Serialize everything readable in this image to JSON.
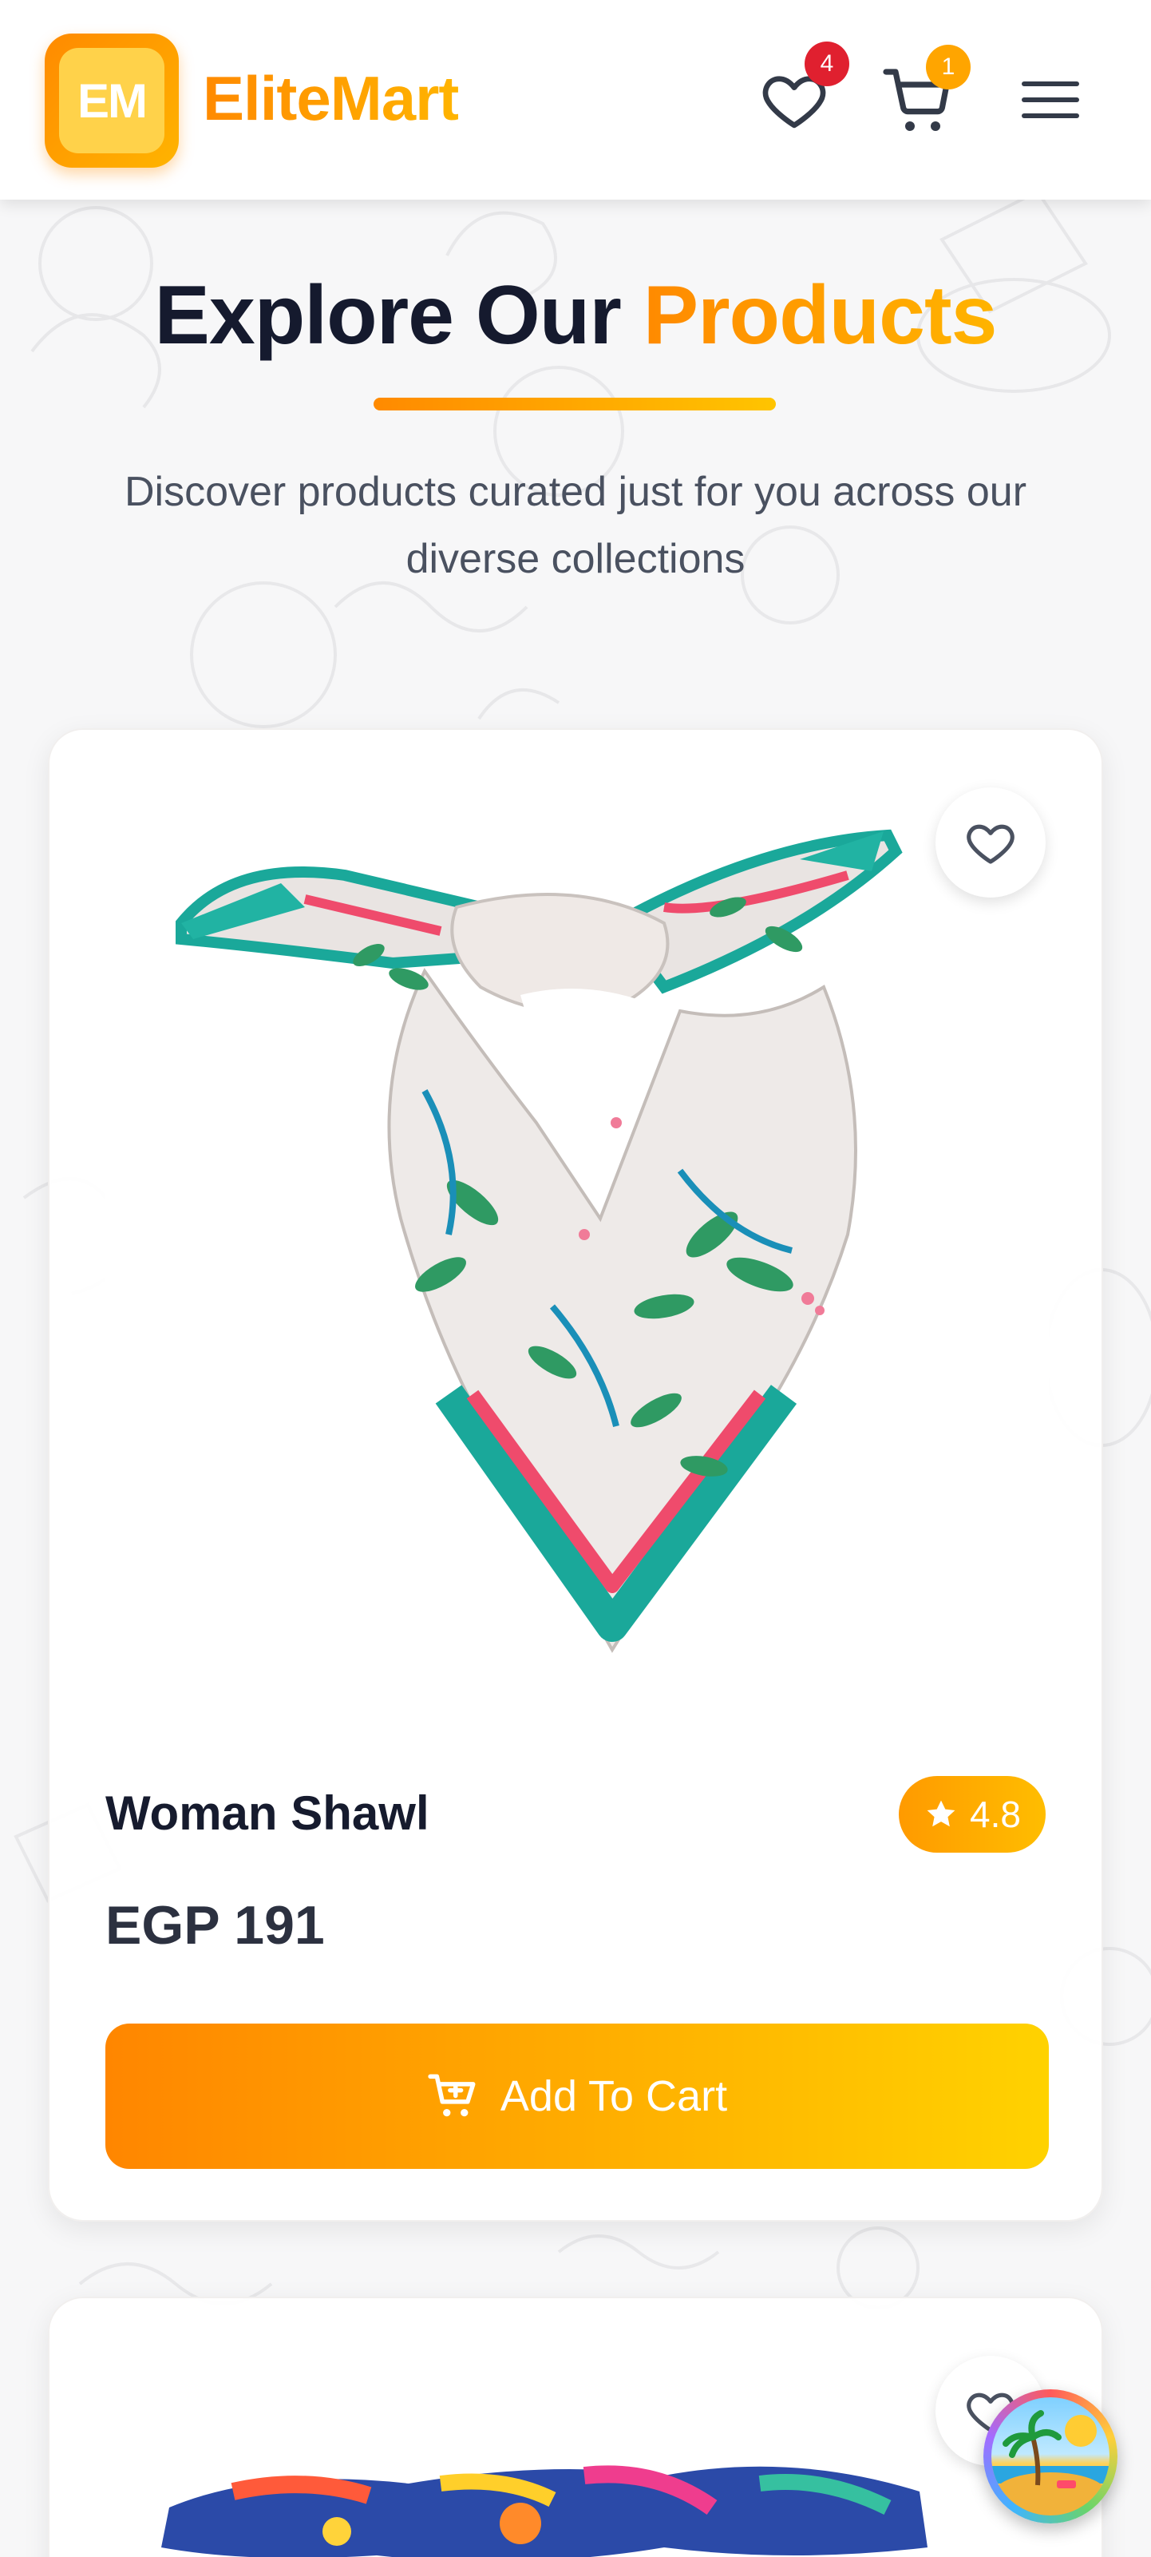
{
  "brand": {
    "logo_text": "EM",
    "name": "EliteMart"
  },
  "header": {
    "wishlist_count": "4",
    "cart_count": "1"
  },
  "hero": {
    "title_part1": "Explore Our",
    "title_accent": "Products",
    "subtitle": "Discover products curated just for you across our diverse collections"
  },
  "products": [
    {
      "name": "Woman Shawl",
      "rating": "4.8",
      "price": "EGP 191",
      "button_label": "Add To Cart"
    }
  ],
  "colors": {
    "accent_start": "#ff8a00",
    "accent_end": "#ffc400",
    "wishlist_badge": "#e0202f",
    "cart_badge": "#ffa500",
    "text_dark": "#161b2e"
  },
  "icons": [
    "heart-icon",
    "cart-icon",
    "menu-icon",
    "star-icon",
    "cart-plus-icon",
    "beach-icon"
  ]
}
